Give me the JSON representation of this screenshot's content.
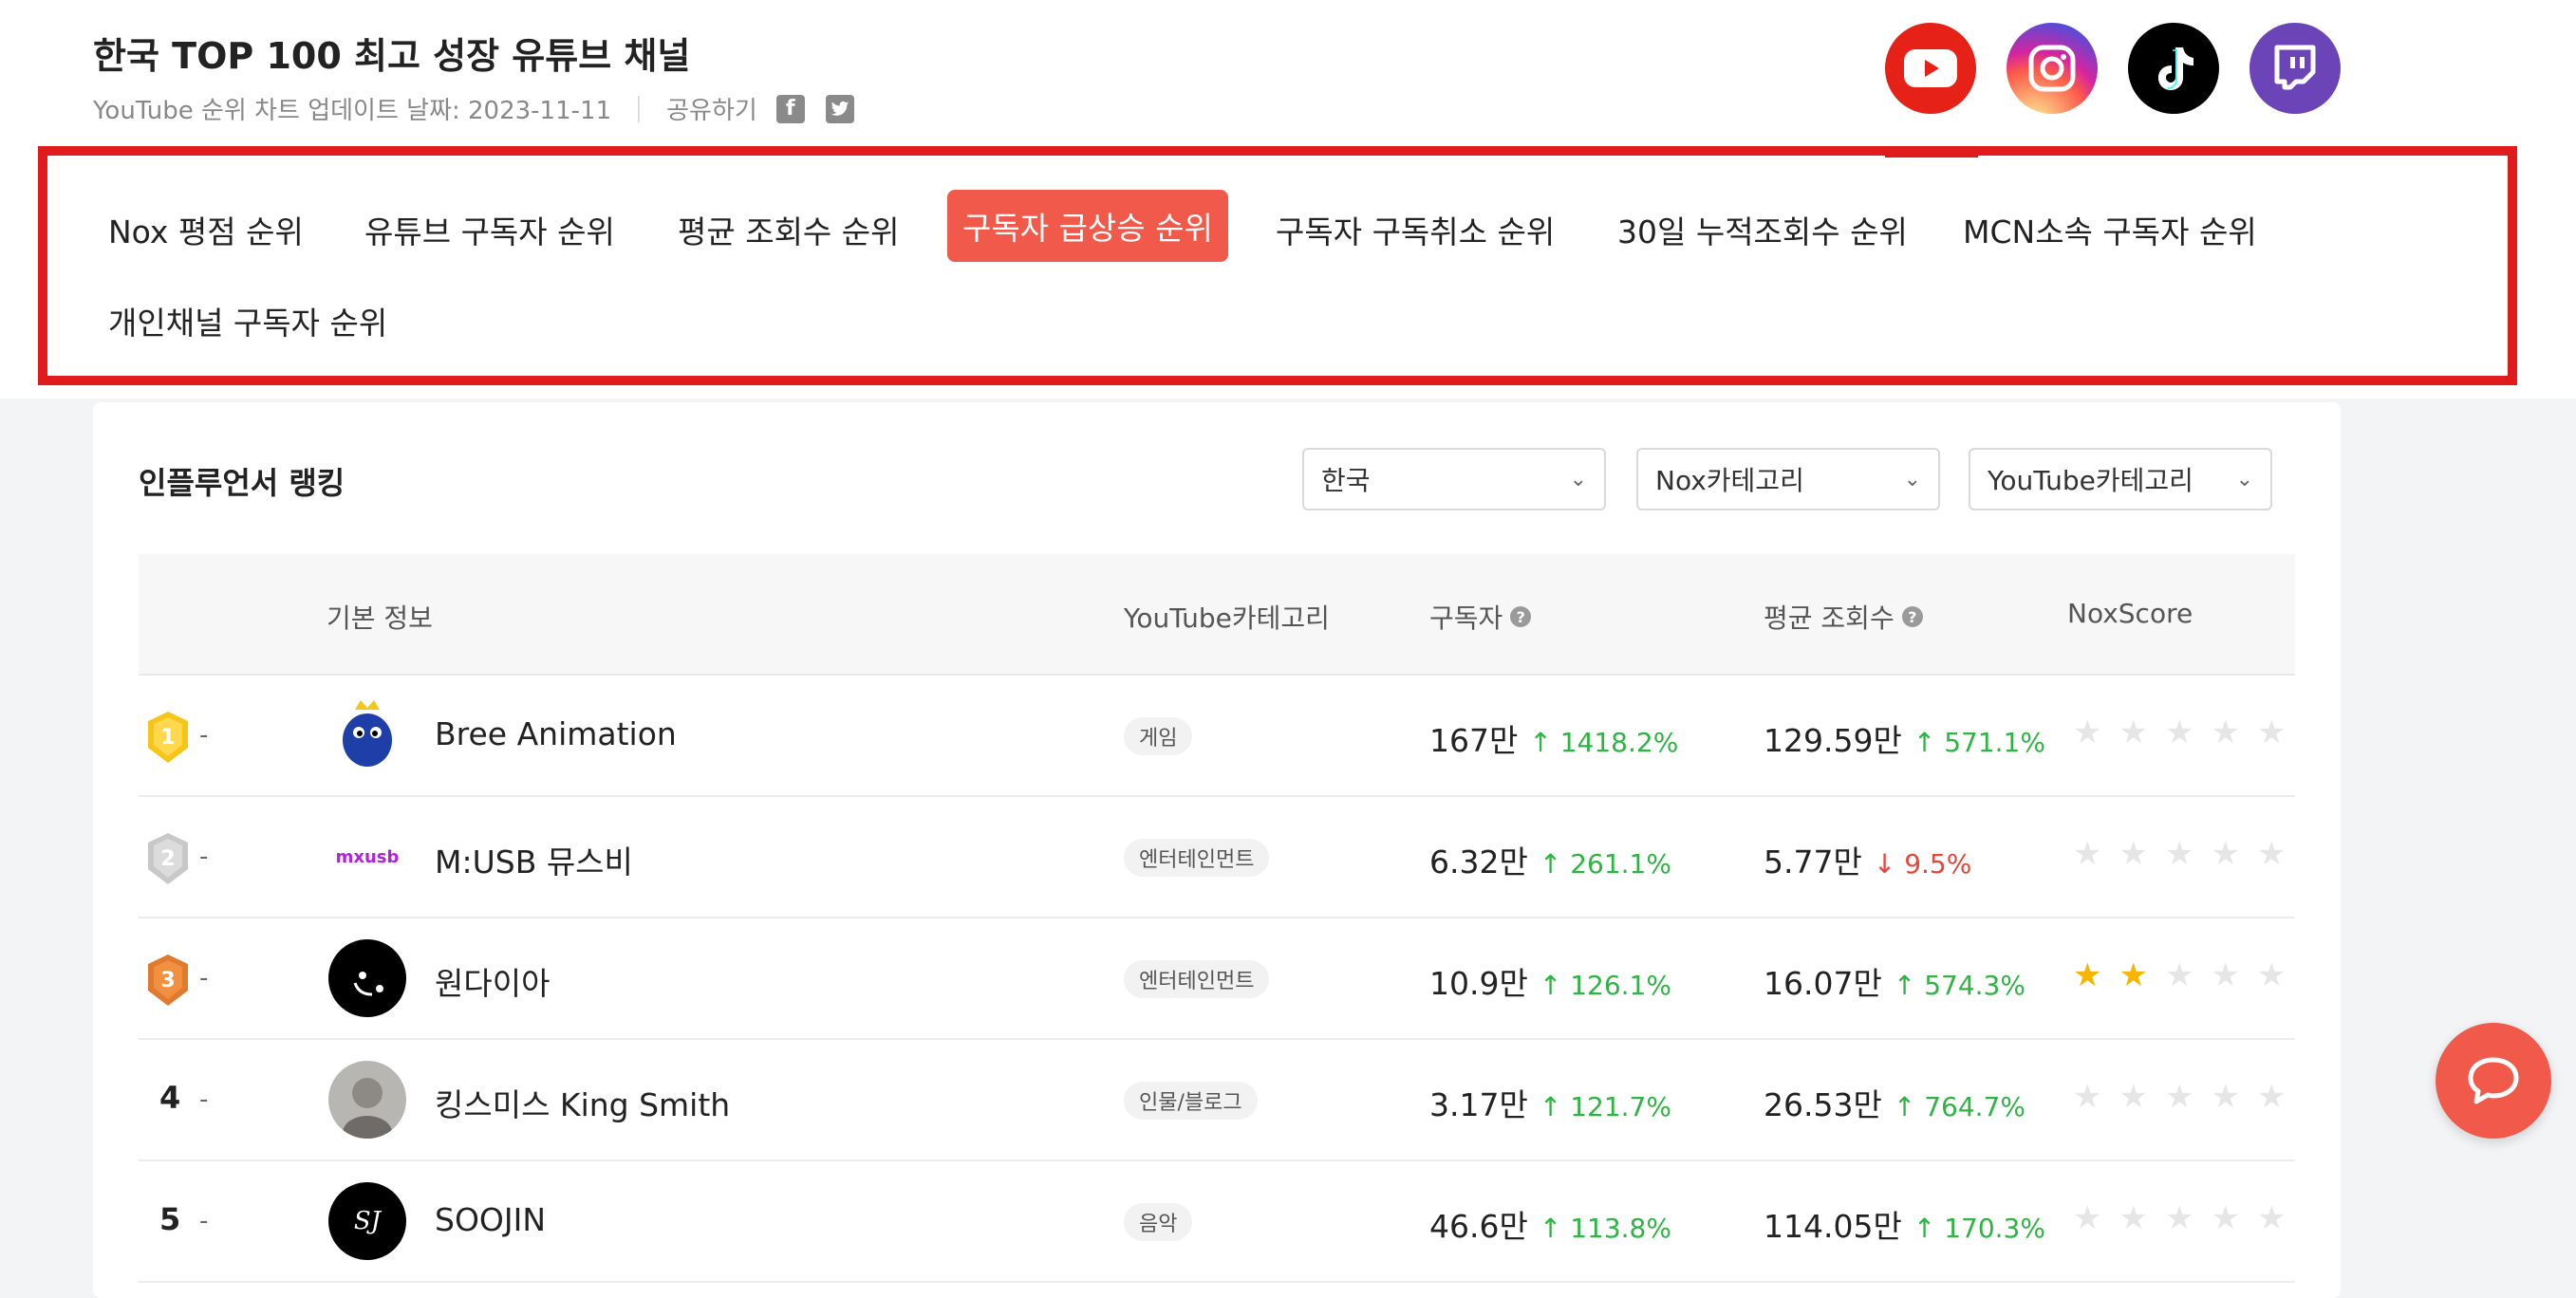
{
  "header": {
    "title": "한국 TOP 100 최고 성장 유튜브 채널",
    "update_text": "YouTube 순위 차트 업데이트 날짜: 2023-11-11",
    "share_label": "공유하기",
    "share_icons": [
      "facebook-icon",
      "twitter-icon"
    ]
  },
  "social": [
    {
      "name": "youtube-icon",
      "color": "#e62117"
    },
    {
      "name": "instagram-icon",
      "color": "#d6249f"
    },
    {
      "name": "tiktok-icon",
      "color": "#000000"
    },
    {
      "name": "twitch-icon",
      "color": "#6b45b8"
    }
  ],
  "tabs": [
    {
      "label": "Nox 평점 순위",
      "active": false
    },
    {
      "label": "유튜브 구독자 순위",
      "active": false
    },
    {
      "label": "평균 조회수 순위",
      "active": false
    },
    {
      "label": "구독자 급상승 순위",
      "active": true
    },
    {
      "label": "구독자 구독취소 순위",
      "active": false
    },
    {
      "label": "30일 누적조회수 순위",
      "active": false
    },
    {
      "label": "MCN소속 구독자 순위",
      "active": false
    },
    {
      "label": "개인채널 구독자 순위",
      "active": false
    }
  ],
  "ranking": {
    "title": "인플루언서 랭킹",
    "filters": [
      "한국",
      "Nox카테고리",
      "YouTube카테고리"
    ],
    "columns": {
      "basic_info": "기본 정보",
      "category": "YouTube카테고리",
      "subscribers": "구독자",
      "avg_views": "평균 조회수",
      "score": "NoxScore"
    },
    "rows": [
      {
        "rank": "1",
        "change": "-",
        "name": "Bree Animation",
        "category": "게임",
        "subs": "167만",
        "subs_change": "↑ 1418.2%",
        "subs_dir": "up",
        "views": "129.59만",
        "views_change": "↑ 571.1%",
        "views_dir": "up",
        "stars": 0
      },
      {
        "rank": "2",
        "change": "-",
        "name": "M:USB 뮤스비",
        "category": "엔터테인먼트",
        "subs": "6.32만",
        "subs_change": "↑ 261.1%",
        "subs_dir": "up",
        "views": "5.77만",
        "views_change": "↓ 9.5%",
        "views_dir": "down",
        "stars": 0
      },
      {
        "rank": "3",
        "change": "-",
        "name": "원다이아",
        "category": "엔터테인먼트",
        "subs": "10.9만",
        "subs_change": "↑ 126.1%",
        "subs_dir": "up",
        "views": "16.07만",
        "views_change": "↑ 574.3%",
        "views_dir": "up",
        "stars": 2
      },
      {
        "rank": "4",
        "change": "-",
        "name": "킹스미스 King Smith",
        "category": "인물/블로그",
        "subs": "3.17만",
        "subs_change": "↑ 121.7%",
        "subs_dir": "up",
        "views": "26.53만",
        "views_change": "↑ 764.7%",
        "views_dir": "up",
        "stars": 0
      },
      {
        "rank": "5",
        "change": "-",
        "name": "SOOJIN",
        "category": "음악",
        "subs": "46.6만",
        "subs_change": "↑ 113.8%",
        "subs_dir": "up",
        "views": "114.05만",
        "views_change": "↑ 170.3%",
        "views_dir": "up",
        "stars": 0
      }
    ]
  },
  "avatar_text": {
    "usb": "mxusb",
    "soojin": "SJ"
  },
  "medal_colors": {
    "gold": "#f5c518",
    "silver": "#c8c8c8",
    "bronze": "#e07a2c"
  },
  "accent": "#f15a4a",
  "outline": "#e01b1b"
}
